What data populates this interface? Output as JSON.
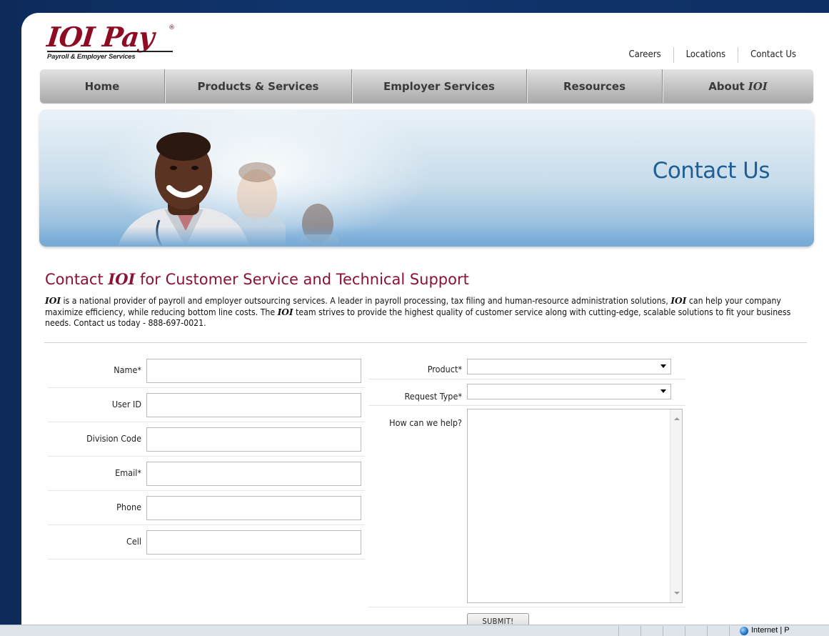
{
  "logo": {
    "brand_ioi": "IOI",
    "brand_pay": "Pay",
    "registered": "®",
    "tagline": "Payroll & Employer Services"
  },
  "top_links": [
    "Careers",
    "Locations",
    "Contact Us"
  ],
  "nav": {
    "home": "Home",
    "products": "Products & Services",
    "employer": "Employer Services",
    "resources": "Resources",
    "about_prefix": "About",
    "about_brand": "IOI"
  },
  "banner": {
    "title": "Contact Us"
  },
  "heading": {
    "prefix": "Contact",
    "brand": "IOI",
    "suffix": "for Customer Service and Technical Support"
  },
  "intro": {
    "brand": "IOI",
    "part1": " is a national provider of payroll and employer outsourcing services. A leader in payroll processing, tax filing and human-resource administration solutions, ",
    "part2": " can help your company maximize efficiency, while reducing bottom line costs. The ",
    "part3": " team strives to provide the highest quality of customer service along with cutting-edge, scalable solutions to fit your business needs. Contact us today - 888-697-0021."
  },
  "form": {
    "name_label": "Name*",
    "name_value": "",
    "userid_label": "User ID",
    "userid_value": "",
    "division_label": "Division Code",
    "division_value": "",
    "email_label": "Email*",
    "email_value": "",
    "phone_label": "Phone",
    "phone_value": "",
    "cell_label": "Cell",
    "cell_value": "",
    "product_label": "Product*",
    "product_value": "",
    "request_label": "Request Type*",
    "request_value": "",
    "help_label": "How can we help?",
    "help_value": "",
    "submit_label": "SUBMIT!"
  },
  "statusbar": {
    "zone": "Internet | P"
  },
  "colors": {
    "brand": "#8d0b23",
    "banner_title": "#1e5f95",
    "heading": "#8a1232"
  }
}
